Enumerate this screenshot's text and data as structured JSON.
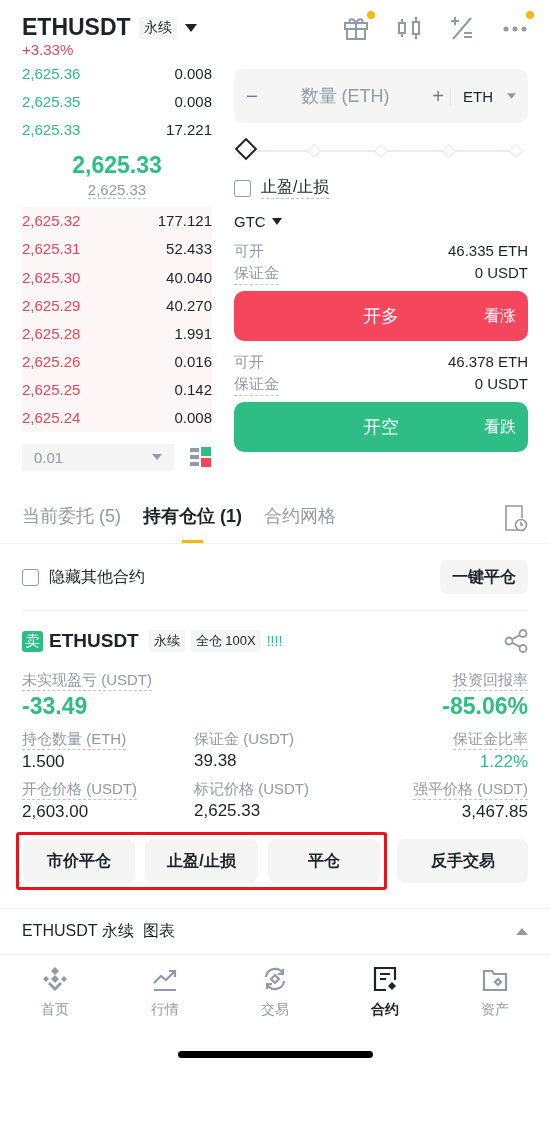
{
  "header": {
    "symbol": "ETHUSDT",
    "type_tag": "永续",
    "change": "+3.33%",
    "icons": [
      {
        "kind": "gift",
        "dot": true
      },
      {
        "kind": "candles",
        "dot": false
      },
      {
        "kind": "calc",
        "dot": false
      },
      {
        "kind": "more",
        "dot": true
      }
    ]
  },
  "order_book": {
    "asks": [
      {
        "price": "2,625.36",
        "amount": "0.008"
      },
      {
        "price": "2,625.35",
        "amount": "0.008"
      },
      {
        "price": "2,625.33",
        "amount": "17.221"
      }
    ],
    "last_price": "2,625.33",
    "mark_price": "2,625.33",
    "bids": [
      {
        "price": "2,625.32",
        "amount": "177.121"
      },
      {
        "price": "2,625.31",
        "amount": "52.433"
      },
      {
        "price": "2,625.30",
        "amount": "40.040"
      },
      {
        "price": "2,625.29",
        "amount": "40.270"
      },
      {
        "price": "2,625.28",
        "amount": "1.991"
      },
      {
        "price": "2,625.26",
        "amount": "0.016"
      },
      {
        "price": "2,625.25",
        "amount": "0.142"
      },
      {
        "price": "2,625.24",
        "amount": "0.008"
      }
    ],
    "precision": "0.01"
  },
  "order_form": {
    "minus": "−",
    "quantity_placeholder": "数量 (ETH)",
    "plus": "+",
    "unit": "ETH",
    "slider": {
      "level": 0
    },
    "tp_sl": {
      "label": "止盈/止损",
      "checked": false
    },
    "time_in_force": "GTC",
    "sides": [
      {
        "kind": "long",
        "rows": [
          {
            "label": "可开",
            "value": "46.335 ETH"
          },
          {
            "label": "保证金",
            "value": "0 USDT"
          }
        ],
        "button": "开多",
        "hint": "看涨"
      },
      {
        "kind": "short",
        "rows": [
          {
            "label": "可开",
            "value": "46.378 ETH"
          },
          {
            "label": "保证金",
            "value": "0 USDT"
          }
        ],
        "button": "开空",
        "hint": "看跌"
      }
    ]
  },
  "tabs": [
    {
      "label": "当前委托 (5)",
      "selected": false
    },
    {
      "label": "持有仓位 (1)",
      "selected": true
    },
    {
      "label": "合约网格",
      "selected": false
    }
  ],
  "hide_others": {
    "label": "隐藏其他合约",
    "checked": false
  },
  "close_all": "一键平仓",
  "position": {
    "side": "卖",
    "symbol": "ETHUSDT",
    "tags": [
      "永续",
      "全仓 100X"
    ],
    "adl": "!!!!",
    "pnl_label": "未实现盈亏 (USDT)",
    "pnl": "-33.49",
    "roe_label": "投资回报率",
    "roe": "-85.06%",
    "fields": [
      {
        "label": "持仓数量 (ETH)",
        "value": "1.500",
        "color": "#1e2329"
      },
      {
        "label": "保证金 (USDT)",
        "value": "39.38",
        "color": "#1e2329"
      },
      {
        "label": "保证金比率",
        "value": "1.22%",
        "color": "#2ebd85"
      },
      {
        "label": "开仓价格 (USDT)",
        "value": "2,603.00",
        "color": "#1e2329"
      },
      {
        "label": "标记价格 (USDT)",
        "value": "2,625.33",
        "color": "#1e2329"
      },
      {
        "label": "强平价格 (USDT)",
        "value": "3,467.85",
        "color": "#1e2329"
      }
    ],
    "buttons": [
      {
        "label": "市价平仓",
        "highlighted": true
      },
      {
        "label": "止盈/止损",
        "highlighted": true
      },
      {
        "label": "平仓",
        "highlighted": true
      },
      {
        "label": "反手交易",
        "highlighted": false
      }
    ]
  },
  "chart_bar": {
    "label": "ETHUSDT 永续  图表"
  },
  "nav": [
    {
      "kind": "home",
      "label": "首页",
      "selected": false
    },
    {
      "kind": "markets",
      "label": "行情",
      "selected": false
    },
    {
      "kind": "trade",
      "label": "交易",
      "selected": false
    },
    {
      "kind": "futures",
      "label": "合约",
      "selected": true
    },
    {
      "kind": "assets",
      "label": "资产",
      "selected": false
    }
  ]
}
